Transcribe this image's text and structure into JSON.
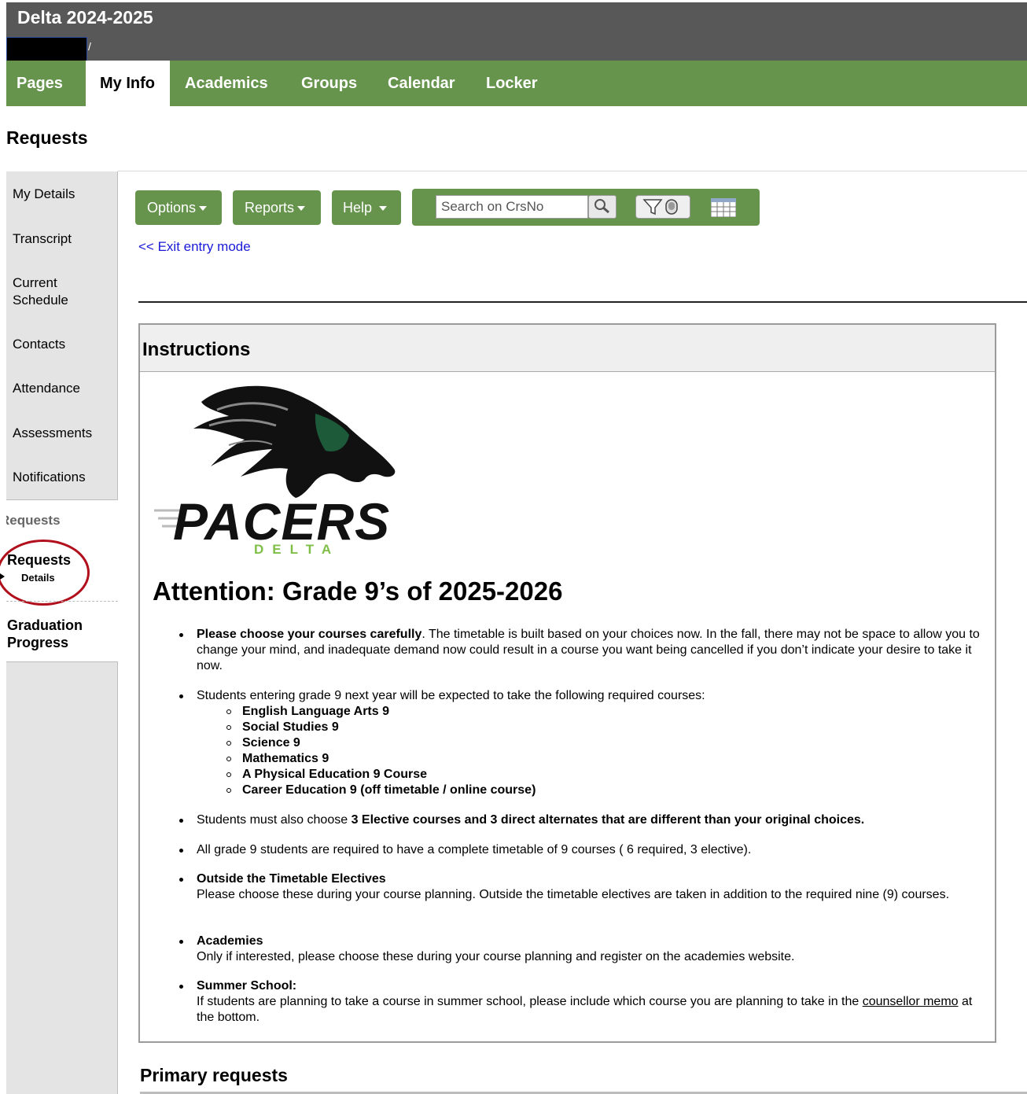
{
  "header": {
    "title": "Delta 2024-2025",
    "user_suffix": "/"
  },
  "nav": {
    "tabs": [
      {
        "label": "Pages"
      },
      {
        "label": "My Info"
      },
      {
        "label": "Academics"
      },
      {
        "label": "Groups"
      },
      {
        "label": "Calendar"
      },
      {
        "label": "Locker"
      }
    ],
    "active": "My Info"
  },
  "page_title": "Requests",
  "sidebar": {
    "items": [
      "My Details",
      "Transcript",
      "Current",
      "Schedule",
      "Contacts",
      "Attendance",
      "Assessments",
      "Notifications"
    ],
    "section_label": "Requests",
    "requests_label": "Requests",
    "details_label": "Details",
    "grad_line1": "Graduation",
    "grad_line2": "Progress"
  },
  "toolbar": {
    "options": "Options",
    "reports": "Reports",
    "help": "Help",
    "search_placeholder": "Search on CrsNo"
  },
  "exit_link": "<< Exit entry mode",
  "instructions": {
    "heading": "Instructions",
    "logo_text": "PACERS",
    "logo_sub": "DELTA",
    "attention": "Attention: Grade 9’s of 2025-2026",
    "b1_bold": "Please choose your courses carefully",
    "b1_rest": ". The timetable is built based on your choices now.   In the fall, there may not be space to allow you to change your mind, and inadequate demand now could result in a course you want being cancelled if you don’t indicate your desire to take it now.",
    "b2": "Students entering grade 9 next year will be expected to take the following required courses:",
    "required": [
      "English Language Arts 9",
      "Social Studies 9",
      "Science 9",
      "Mathematics 9",
      "A Physical Education 9 Course",
      "Career Education 9 (off timetable / online course)"
    ],
    "b3_pre": "Students must also choose ",
    "b3_bold": "3 Elective courses and 3 direct alternates that are different than your original choices.",
    "b4": "All grade 9 students are required to have a complete timetable of 9 courses ( 6 required, 3 elective).",
    "b5_title": "Outside the Timetable Electives",
    "b5_text": "Please choose these during your course planning.  Outside the timetable electives are taken in addition to the required nine (9) courses.",
    "b6_title": "Academies",
    "b6_text": "Only if interested, please choose these during your course planning and register on the academies website.",
    "b7_title": "Summer School:",
    "b7_pre": "If students are planning to take a course in summer school, please include which course you are planning to take in the ",
    "b7_link": "counsellor memo",
    "b7_post": " at the bottom."
  },
  "primary_requests": "Primary requests",
  "colors": {
    "nav_green": "#66944c",
    "header_gray": "#585858",
    "logo_green": "#7fbf48",
    "circle_red": "#b10f1c"
  }
}
